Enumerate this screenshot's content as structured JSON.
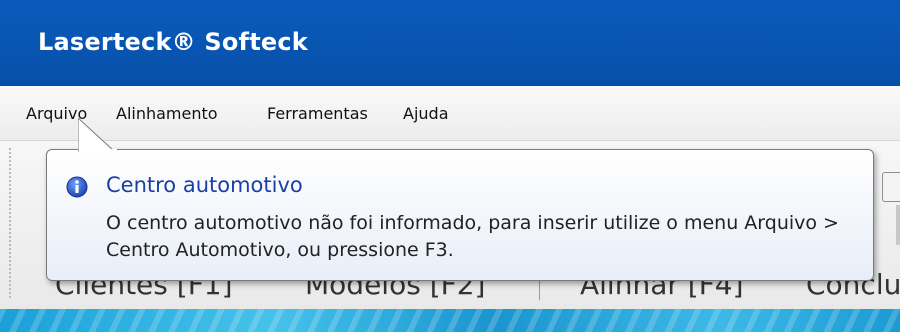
{
  "window": {
    "title": "Laserteck® Softeck"
  },
  "menu": {
    "items": [
      {
        "label": "Arquivo"
      },
      {
        "label": "Alinhamento"
      },
      {
        "label": "Ferramentas"
      },
      {
        "label": "Ajuda"
      }
    ]
  },
  "tabs": {
    "items": [
      {
        "label": "Clientes [F1]"
      },
      {
        "label": "Modelos [F2]"
      },
      {
        "label": "Alinhar [F4]"
      },
      {
        "label": "Conclu"
      }
    ]
  },
  "balloon": {
    "icon": "info-icon",
    "title": "Centro automotivo",
    "message": "O centro automotivo não foi informado, para inserir utilize o menu Arquivo > Centro Automotivo, ou pressione F3."
  },
  "colors": {
    "titlebar": "#0750a9",
    "balloon_title": "#1a3fa8",
    "backdrop": "#1aa0d8"
  }
}
